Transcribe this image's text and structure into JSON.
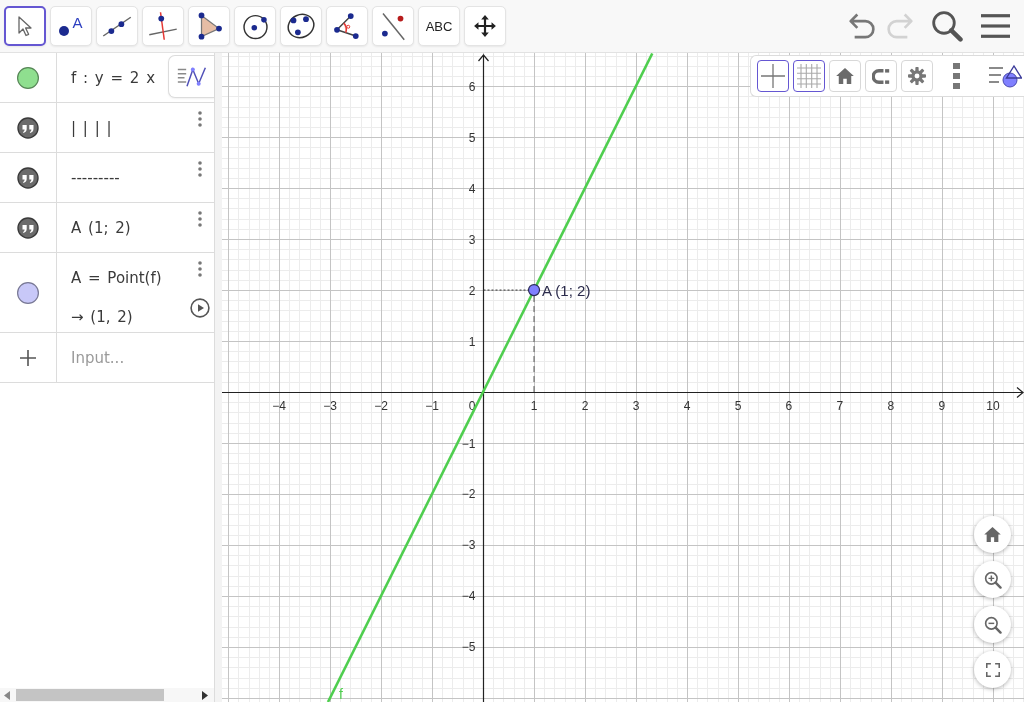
{
  "toolbar": {
    "tools": [
      {
        "kind": "move",
        "selected": true
      },
      {
        "kind": "point",
        "label": "A",
        "selected": false
      },
      {
        "kind": "line",
        "selected": false
      },
      {
        "kind": "perpendicular",
        "selected": false
      },
      {
        "kind": "polygon",
        "selected": false
      },
      {
        "kind": "circle",
        "selected": false
      },
      {
        "kind": "ellipse",
        "selected": false
      },
      {
        "kind": "angle",
        "selected": false
      },
      {
        "kind": "reflect",
        "selected": false
      },
      {
        "kind": "text",
        "label": "ABC",
        "selected": false
      },
      {
        "kind": "pan",
        "selected": false
      }
    ],
    "actions": [
      {
        "kind": "undo",
        "disabled": false
      },
      {
        "kind": "redo",
        "disabled": true
      },
      {
        "kind": "search",
        "disabled": false
      },
      {
        "kind": "menu",
        "disabled": false
      }
    ]
  },
  "algebra": {
    "rows": [
      {
        "kind": "function",
        "color": "#8fdf8f",
        "definition": "f : y = 2 x"
      },
      {
        "kind": "text",
        "definition": "| | | |"
      },
      {
        "kind": "text",
        "definition": "---------"
      },
      {
        "kind": "text",
        "definition": "A (1; 2)"
      },
      {
        "kind": "point",
        "color": "#c8c8f8",
        "definition": "A = Point(f)",
        "value": "→ (1, 2)",
        "play_button": true
      }
    ],
    "input": {
      "placeholder": "Input..."
    }
  },
  "graphics": {
    "stylebar": {
      "toggles": [
        {
          "kind": "axes",
          "on": true
        },
        {
          "kind": "grid",
          "on": true
        }
      ],
      "buttons": [
        {
          "kind": "home"
        },
        {
          "kind": "capture"
        },
        {
          "kind": "settings"
        }
      ]
    },
    "origin_label": "0",
    "chart_data": {
      "type": "line",
      "grid": true,
      "x": [
        -3.04,
        3.32
      ],
      "series": [
        {
          "name": "f",
          "color": "#4fce4f",
          "values": [
            -6.08,
            6.64
          ]
        }
      ],
      "xlim": [
        -5.12,
        10.61
      ],
      "ylim": [
        -6.08,
        6.65
      ],
      "xticks": [
        {
          "value": -4,
          "label": "−4"
        },
        {
          "value": -3,
          "label": "−3"
        },
        {
          "value": -2,
          "label": "−2"
        },
        {
          "value": -1,
          "label": "−1"
        },
        1,
        2,
        3,
        4,
        5,
        6,
        7,
        8,
        9,
        10
      ],
      "yticks": [
        {
          "value": -5,
          "label": "−5"
        },
        {
          "value": -4,
          "label": "−4"
        },
        {
          "value": -3,
          "label": "−3"
        },
        {
          "value": -2,
          "label": "−2"
        },
        {
          "value": -1,
          "label": "−1"
        },
        1,
        2,
        3,
        4,
        5,
        6
      ],
      "annotations": [
        {
          "text": "A (1; 2)",
          "x": 1,
          "y": 2
        }
      ]
    }
  }
}
